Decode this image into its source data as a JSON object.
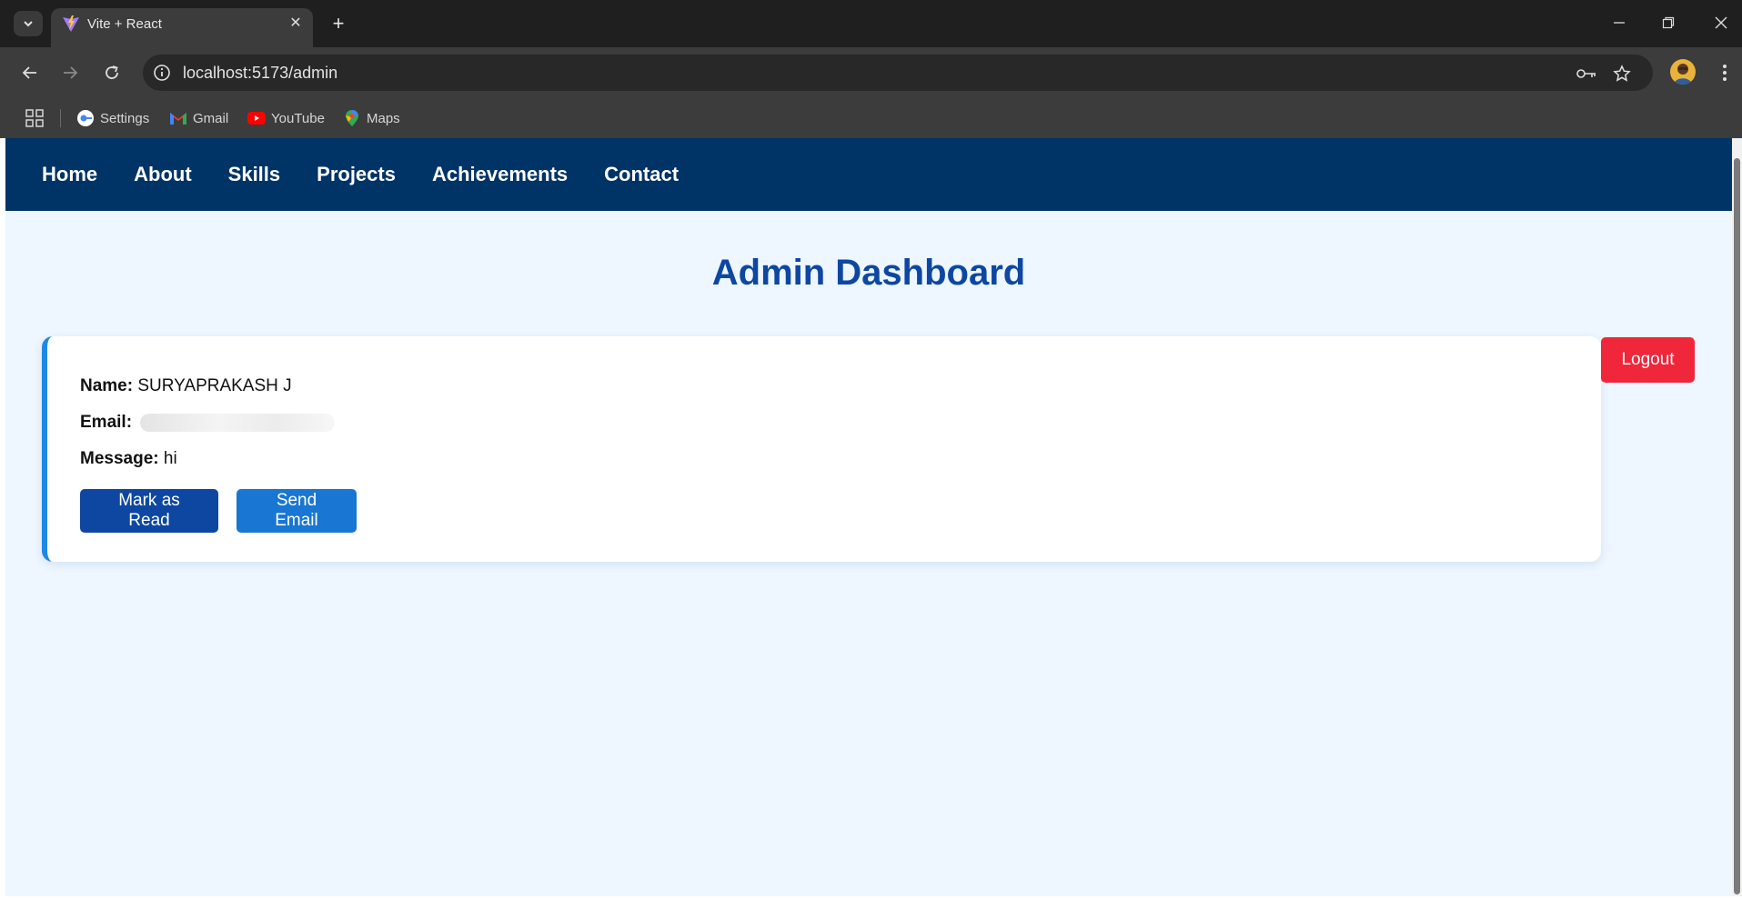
{
  "browser": {
    "tab_title": "Vite + React",
    "url": "localhost:5173/admin",
    "bookmarks": [
      {
        "label": "Settings",
        "icon": "settings-icon"
      },
      {
        "label": "Gmail",
        "icon": "gmail-icon"
      },
      {
        "label": "YouTube",
        "icon": "youtube-icon"
      },
      {
        "label": "Maps",
        "icon": "maps-icon"
      }
    ]
  },
  "nav": {
    "items": [
      "Home",
      "About",
      "Skills",
      "Projects",
      "Achievements",
      "Contact"
    ]
  },
  "page": {
    "title": "Admin Dashboard",
    "logout_label": "Logout"
  },
  "message": {
    "name_label": "Name:",
    "name": "SURYAPRAKASH J",
    "email_label": "Email:",
    "message_label": "Message:",
    "message": "hi",
    "mark_read_label": "Mark as Read",
    "send_email_label": "Send Email"
  },
  "colors": {
    "nav_bg": "#003366",
    "page_bg": "#eef6ff",
    "title": "#0d47a1",
    "accent": "#1e88e5",
    "logout": "#f0263b"
  }
}
